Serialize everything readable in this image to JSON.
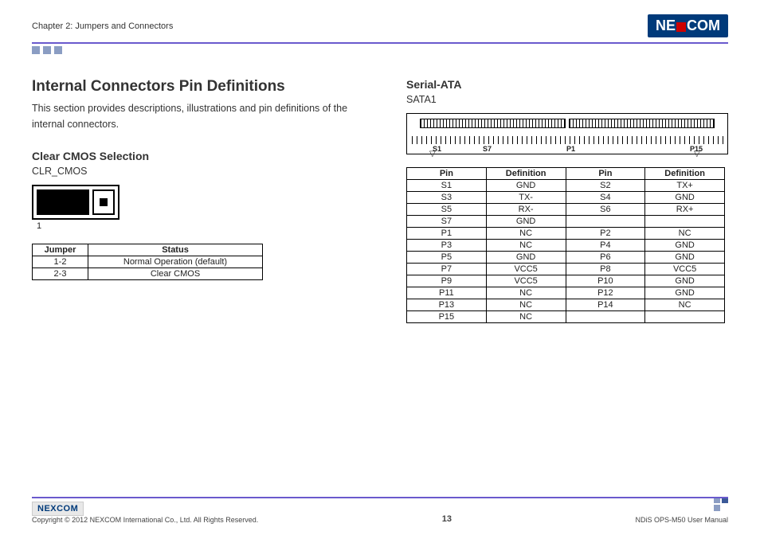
{
  "header": {
    "chapter": "Chapter 2: Jumpers and Connectors",
    "brand": "NEXCOM"
  },
  "left": {
    "title": "Internal Connectors Pin Definitions",
    "intro": "This section provides descriptions, illustrations and pin definitions of the internal connectors.",
    "cmos_heading": "Clear CMOS Selection",
    "cmos_label": "CLR_CMOS",
    "pin1": "1",
    "cmos_table": {
      "headers": [
        "Jumper",
        "Status"
      ],
      "rows": [
        [
          "1-2",
          "Normal Operation (default)"
        ],
        [
          "2-3",
          "Clear CMOS"
        ]
      ]
    }
  },
  "right": {
    "heading": "Serial-ATA",
    "label": "SATA1",
    "diagram_labels": {
      "s1": "S1",
      "s7": "S7",
      "p1": "P1",
      "p15": "P15"
    },
    "table": {
      "headers": [
        "Pin",
        "Definition",
        "Pin",
        "Definition"
      ],
      "rows": [
        [
          "S1",
          "GND",
          "S2",
          "TX+"
        ],
        [
          "S3",
          "TX-",
          "S4",
          "GND"
        ],
        [
          "S5",
          "RX-",
          "S6",
          "RX+"
        ],
        [
          "S7",
          "GND",
          "",
          ""
        ],
        [
          "P1",
          "NC",
          "P2",
          "NC"
        ],
        [
          "P3",
          "NC",
          "P4",
          "GND"
        ],
        [
          "P5",
          "GND",
          "P6",
          "GND"
        ],
        [
          "P7",
          "VCC5",
          "P8",
          "VCC5"
        ],
        [
          "P9",
          "VCC5",
          "P10",
          "GND"
        ],
        [
          "P11",
          "NC",
          "P12",
          "GND"
        ],
        [
          "P13",
          "NC",
          "P14",
          "NC"
        ],
        [
          "P15",
          "NC",
          "",
          ""
        ]
      ]
    }
  },
  "footer": {
    "copyright": "Copyright © 2012 NEXCOM International Co., Ltd. All Rights Reserved.",
    "page": "13",
    "manual": "NDiS OPS-M50 User Manual",
    "brand_small": "NEXCOM"
  }
}
